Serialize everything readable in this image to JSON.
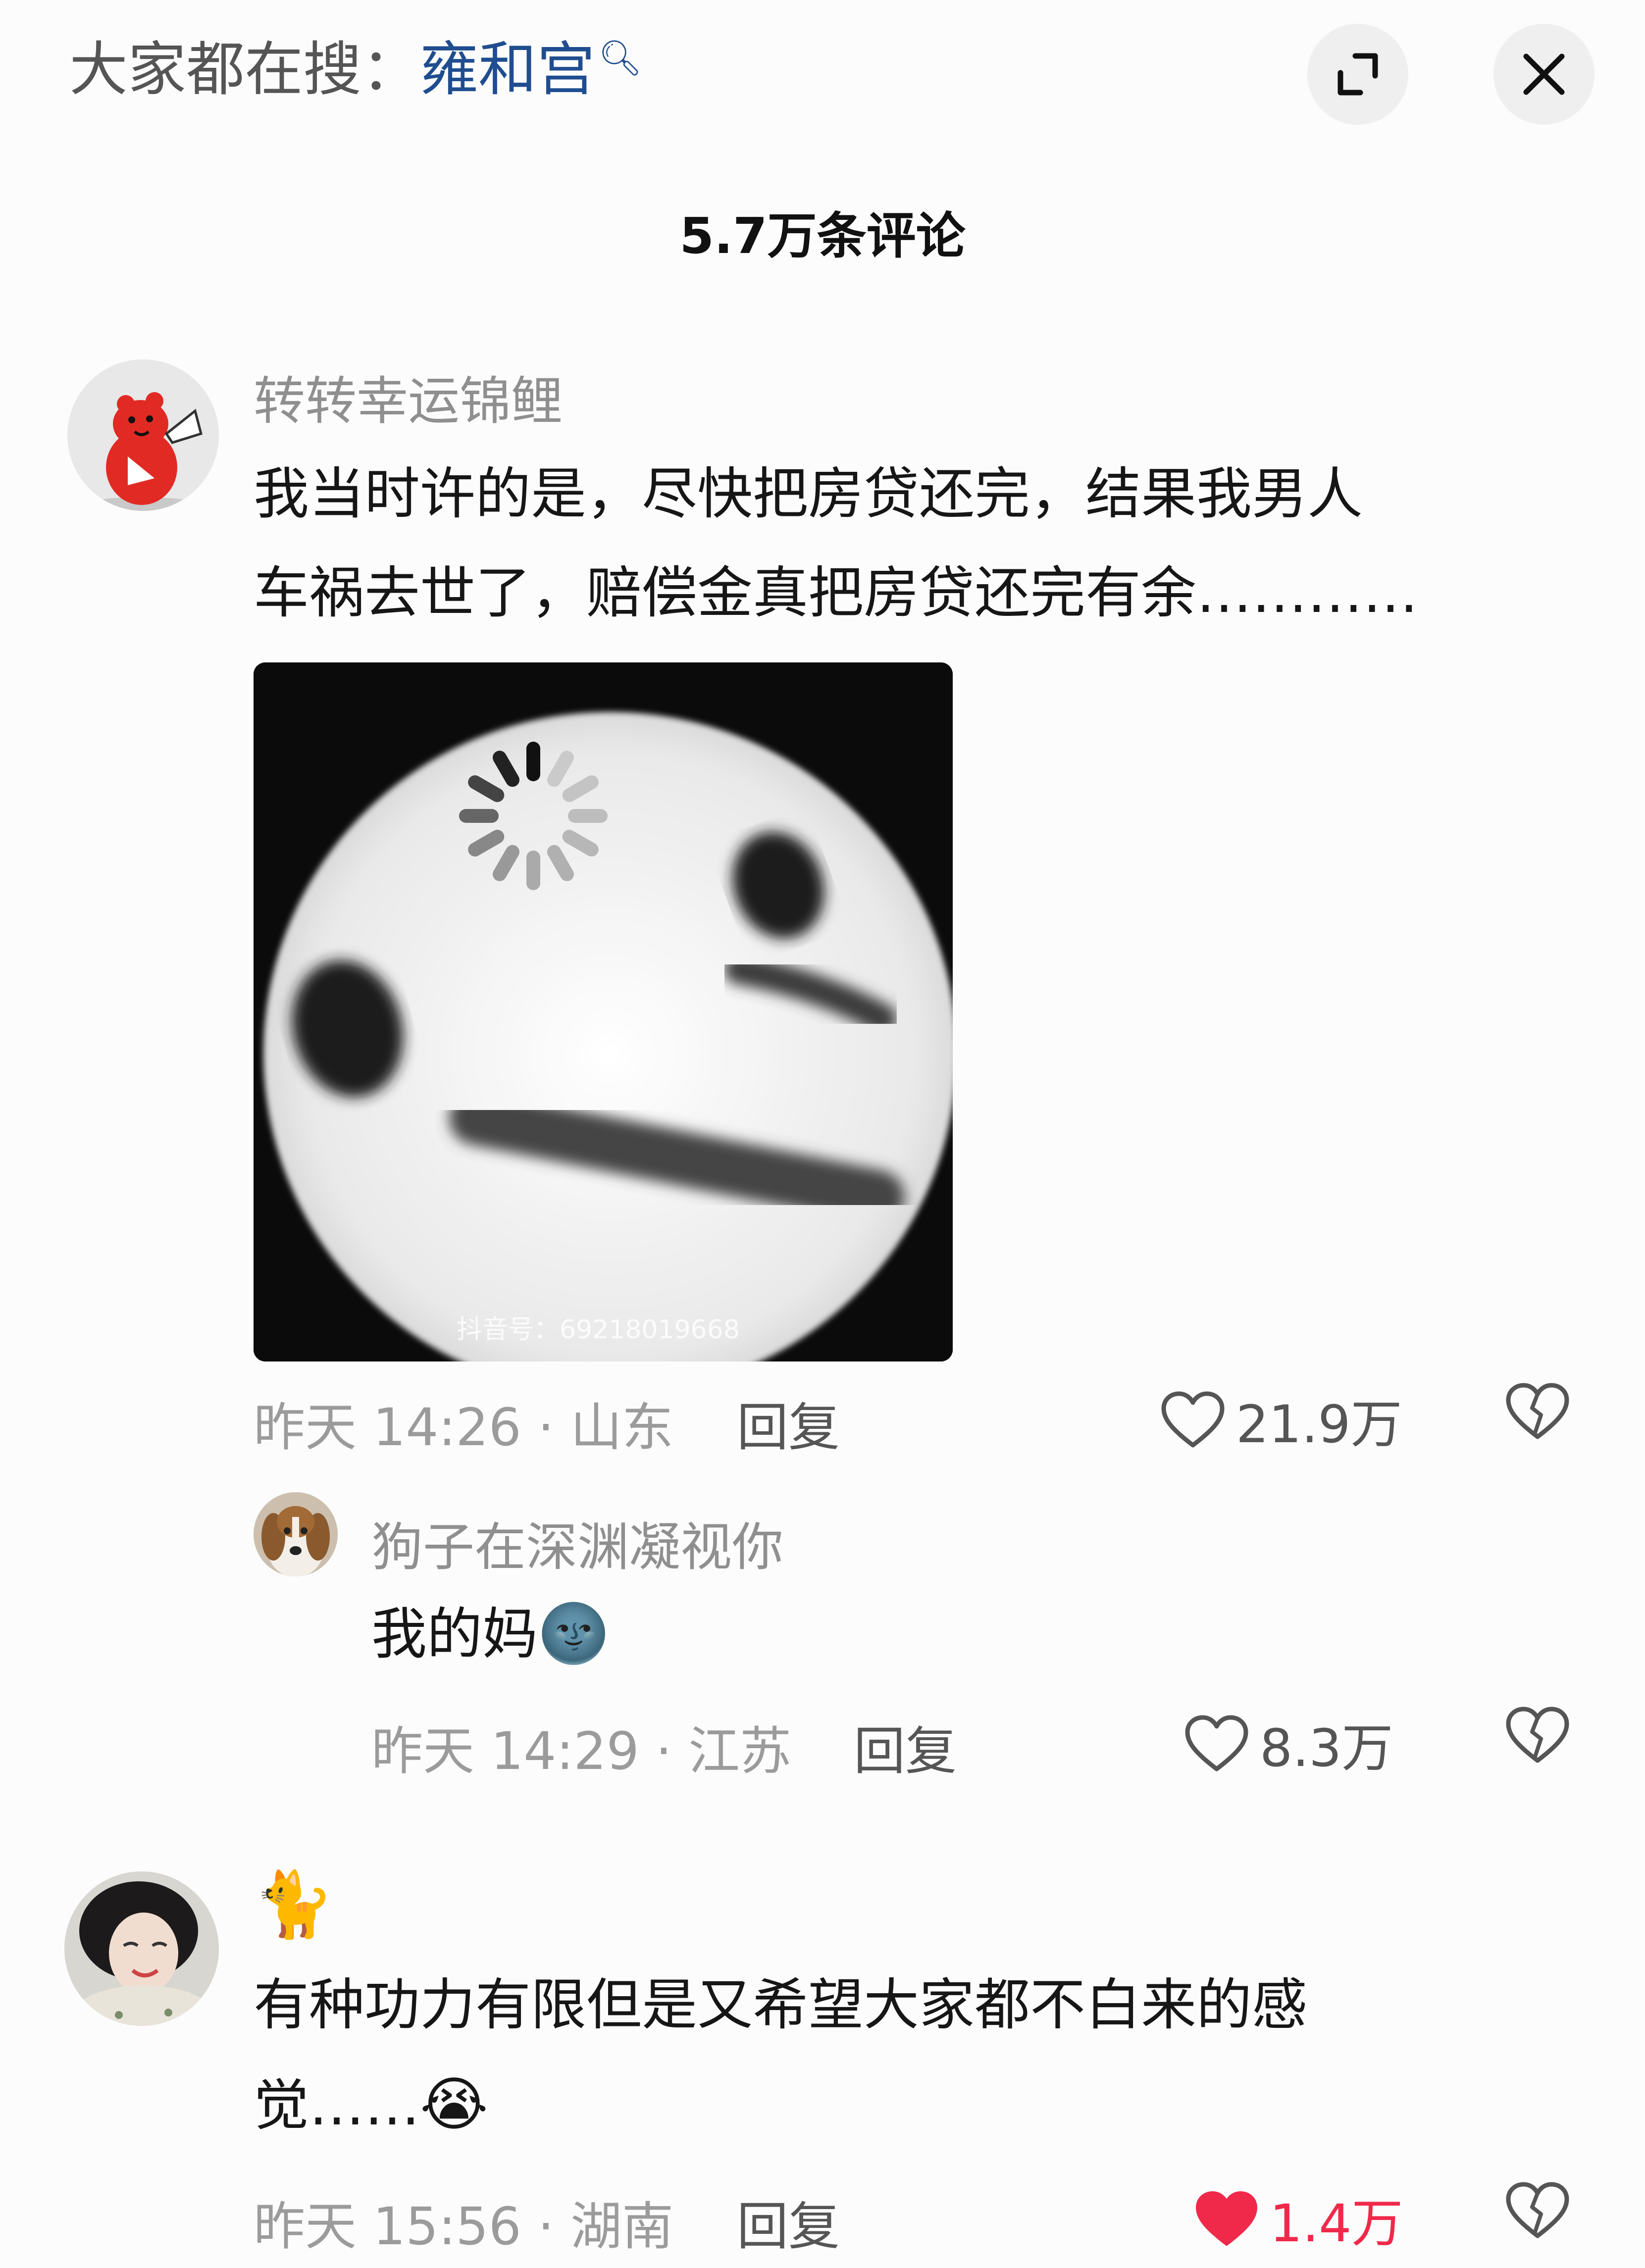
{
  "topbar": {
    "search_prefix": "大家都在搜：",
    "search_keyword": "雍和宫",
    "expand_icon": "expand-icon",
    "close_icon": "close-icon"
  },
  "comment_count": "5.7万条评论",
  "comments": [
    {
      "username": "转转幸运锦鲤",
      "text_line1": "我当时许的是，尽快把房贷还完，结果我男人",
      "text_line2": "车祸去世了，赔偿金真把房贷还完有余…………",
      "image_watermark": "抖音号：69218019668",
      "meta": "昨天 14:26 · 山东",
      "reply_label": "回复",
      "likes": "21.9万",
      "liked": false,
      "replies": [
        {
          "username": "狗子在深渊凝视你",
          "text": "我的妈",
          "emoji": "🌚",
          "meta": "昨天 14:29 · 江苏",
          "reply_label": "回复",
          "likes": "8.3万",
          "liked": false
        }
      ]
    },
    {
      "username": "🐈",
      "text_line1": "有种功力有限但是又希望大家都不白来的感",
      "text_line2": "觉……",
      "emoji": "😭",
      "meta": "昨天 15:56 · 湖南",
      "reply_label": "回复",
      "likes": "1.4万",
      "liked": true
    }
  ],
  "colors": {
    "keyword": "#1f4d8f",
    "liked_heart": "#f0294a",
    "meta_gray": "#9b9b9b"
  }
}
